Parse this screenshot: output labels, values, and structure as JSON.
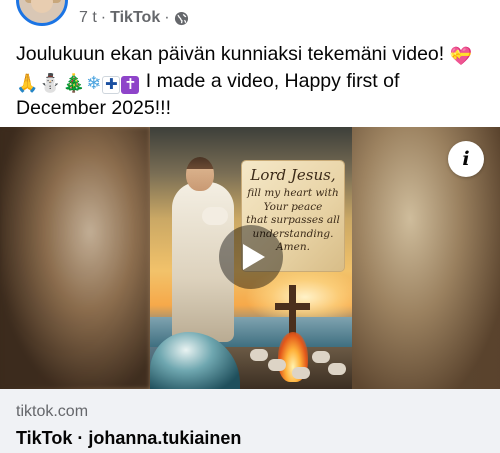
{
  "post": {
    "time": "7 t",
    "separator": "·",
    "source": "TikTok",
    "audience_icon": "globe-icon",
    "text_line1": "Joulukuun ekan päivän kunniaksi tekemäni video!",
    "text_line2_after_emoji": "I made a video, Happy first of",
    "text_line3": "December 2025!!!",
    "emojis": [
      "heart-with-ribbon",
      "folded-hands",
      "snowman",
      "christmas-tree",
      "snowflake",
      "finland-flag",
      "latin-cross"
    ]
  },
  "media": {
    "scroll_title": "Lord Jesus,",
    "scroll_lines": [
      "fill my heart with",
      "Your peace",
      "that surpasses all",
      "understanding.",
      "Amen."
    ],
    "play_icon": "play-icon",
    "info_label": "i"
  },
  "link": {
    "domain": "tiktok.com",
    "title": "TikTok · johanna.tukiainen"
  },
  "colors": {
    "accent": "#1b74e4",
    "secondary_text": "#65676b",
    "link_bg": "#f0f2f5"
  }
}
